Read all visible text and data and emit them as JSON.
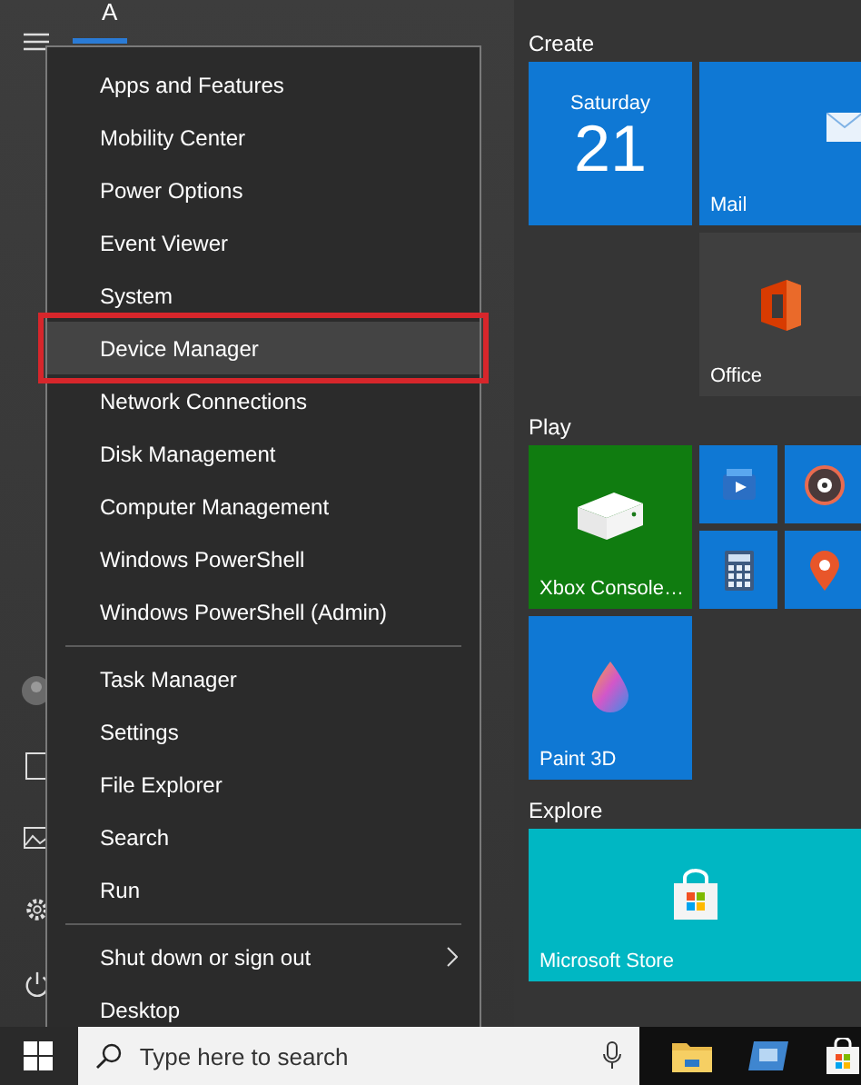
{
  "app_list": {
    "letter": "A"
  },
  "context_menu": {
    "groups": [
      {
        "items": [
          {
            "label": "Apps and Features",
            "selected": false,
            "kind": "item"
          },
          {
            "label": "Mobility Center",
            "selected": false,
            "kind": "item"
          },
          {
            "label": "Power Options",
            "selected": false,
            "kind": "item"
          },
          {
            "label": "Event Viewer",
            "selected": false,
            "kind": "item"
          },
          {
            "label": "System",
            "selected": false,
            "kind": "item"
          },
          {
            "label": "Device Manager",
            "selected": true,
            "kind": "item"
          },
          {
            "label": "Network Connections",
            "selected": false,
            "kind": "item"
          },
          {
            "label": "Disk Management",
            "selected": false,
            "kind": "item"
          },
          {
            "label": "Computer Management",
            "selected": false,
            "kind": "item"
          },
          {
            "label": "Windows PowerShell",
            "selected": false,
            "kind": "item"
          },
          {
            "label": "Windows PowerShell (Admin)",
            "selected": false,
            "kind": "item"
          }
        ]
      },
      {
        "items": [
          {
            "label": "Task Manager",
            "selected": false,
            "kind": "item"
          },
          {
            "label": "Settings",
            "selected": false,
            "kind": "item"
          },
          {
            "label": "File Explorer",
            "selected": false,
            "kind": "item"
          },
          {
            "label": "Search",
            "selected": false,
            "kind": "item"
          },
          {
            "label": "Run",
            "selected": false,
            "kind": "item"
          }
        ]
      },
      {
        "items": [
          {
            "label": "Shut down or sign out",
            "selected": false,
            "kind": "submenu"
          },
          {
            "label": "Desktop",
            "selected": false,
            "kind": "item"
          }
        ]
      }
    ]
  },
  "tile_groups": [
    {
      "title": "Create",
      "tiles": [
        {
          "kind": "calendar",
          "day": "Saturday",
          "date": "21"
        },
        {
          "kind": "mail",
          "label": "Mail"
        },
        {
          "kind": "office",
          "label": "Office"
        }
      ]
    },
    {
      "title": "Play",
      "tiles": [
        {
          "kind": "xbox",
          "label": "Xbox Console…"
        },
        {
          "kind": "movies"
        },
        {
          "kind": "groove"
        },
        {
          "kind": "calculator"
        },
        {
          "kind": "maps"
        },
        {
          "kind": "paint",
          "label": "Paint 3D"
        }
      ]
    },
    {
      "title": "Explore",
      "tiles": [
        {
          "kind": "store",
          "label": "Microsoft Store"
        }
      ]
    }
  ],
  "taskbar": {
    "search": {
      "placeholder": "Type here to search"
    }
  }
}
